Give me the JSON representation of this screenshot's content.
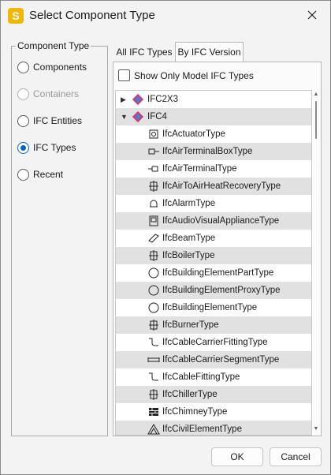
{
  "window": {
    "title": "Select Component Type",
    "app_icon_letter": "S"
  },
  "left": {
    "legend": "Component Type",
    "options": [
      {
        "label": "Components",
        "state": "enabled"
      },
      {
        "label": "Containers",
        "state": "disabled"
      },
      {
        "label": "IFC Entities",
        "state": "enabled"
      },
      {
        "label": "IFC Types",
        "state": "checked"
      },
      {
        "label": "Recent",
        "state": "enabled"
      }
    ]
  },
  "tabs": [
    {
      "label": "All IFC Types",
      "active": false
    },
    {
      "label": "By IFC Version",
      "active": true
    }
  ],
  "filter": {
    "label": "Show Only Model IFC Types",
    "checked": false
  },
  "tree": {
    "roots": [
      {
        "label": "IFC2X3",
        "expanded": false
      },
      {
        "label": "IFC4",
        "expanded": true
      }
    ],
    "items": [
      {
        "label": "IfcActuatorType",
        "icon": "actuator-icon"
      },
      {
        "label": "IfcAirTerminalBoxType",
        "icon": "air-terminal-box-icon"
      },
      {
        "label": "IfcAirTerminalType",
        "icon": "air-terminal-icon"
      },
      {
        "label": "IfcAirToAirHeatRecoveryType",
        "icon": "heat-recovery-icon"
      },
      {
        "label": "IfcAlarmType",
        "icon": "alarm-icon"
      },
      {
        "label": "IfcAudioVisualApplianceType",
        "icon": "audio-visual-icon"
      },
      {
        "label": "IfcBeamType",
        "icon": "beam-icon"
      },
      {
        "label": "IfcBoilerType",
        "icon": "boiler-icon"
      },
      {
        "label": "IfcBuildingElementPartType",
        "icon": "circle-icon"
      },
      {
        "label": "IfcBuildingElementProxyType",
        "icon": "circle-icon"
      },
      {
        "label": "IfcBuildingElementType",
        "icon": "circle-icon"
      },
      {
        "label": "IfcBurnerType",
        "icon": "burner-icon"
      },
      {
        "label": "IfcCableCarrierFittingType",
        "icon": "cable-carrier-fitting-icon"
      },
      {
        "label": "IfcCableCarrierSegmentType",
        "icon": "cable-carrier-segment-icon"
      },
      {
        "label": "IfcCableFittingType",
        "icon": "cable-fitting-icon"
      },
      {
        "label": "IfcChillerType",
        "icon": "chiller-icon"
      },
      {
        "label": "IfcChimneyType",
        "icon": "chimney-icon"
      },
      {
        "label": "IfcCivilElementType",
        "icon": "civil-element-icon"
      }
    ]
  },
  "buttons": {
    "ok": "OK",
    "cancel": "Cancel"
  },
  "colors": {
    "accent": "#0067c0",
    "row_alt": "#e1e1e1",
    "app_icon": "#f2b705"
  }
}
